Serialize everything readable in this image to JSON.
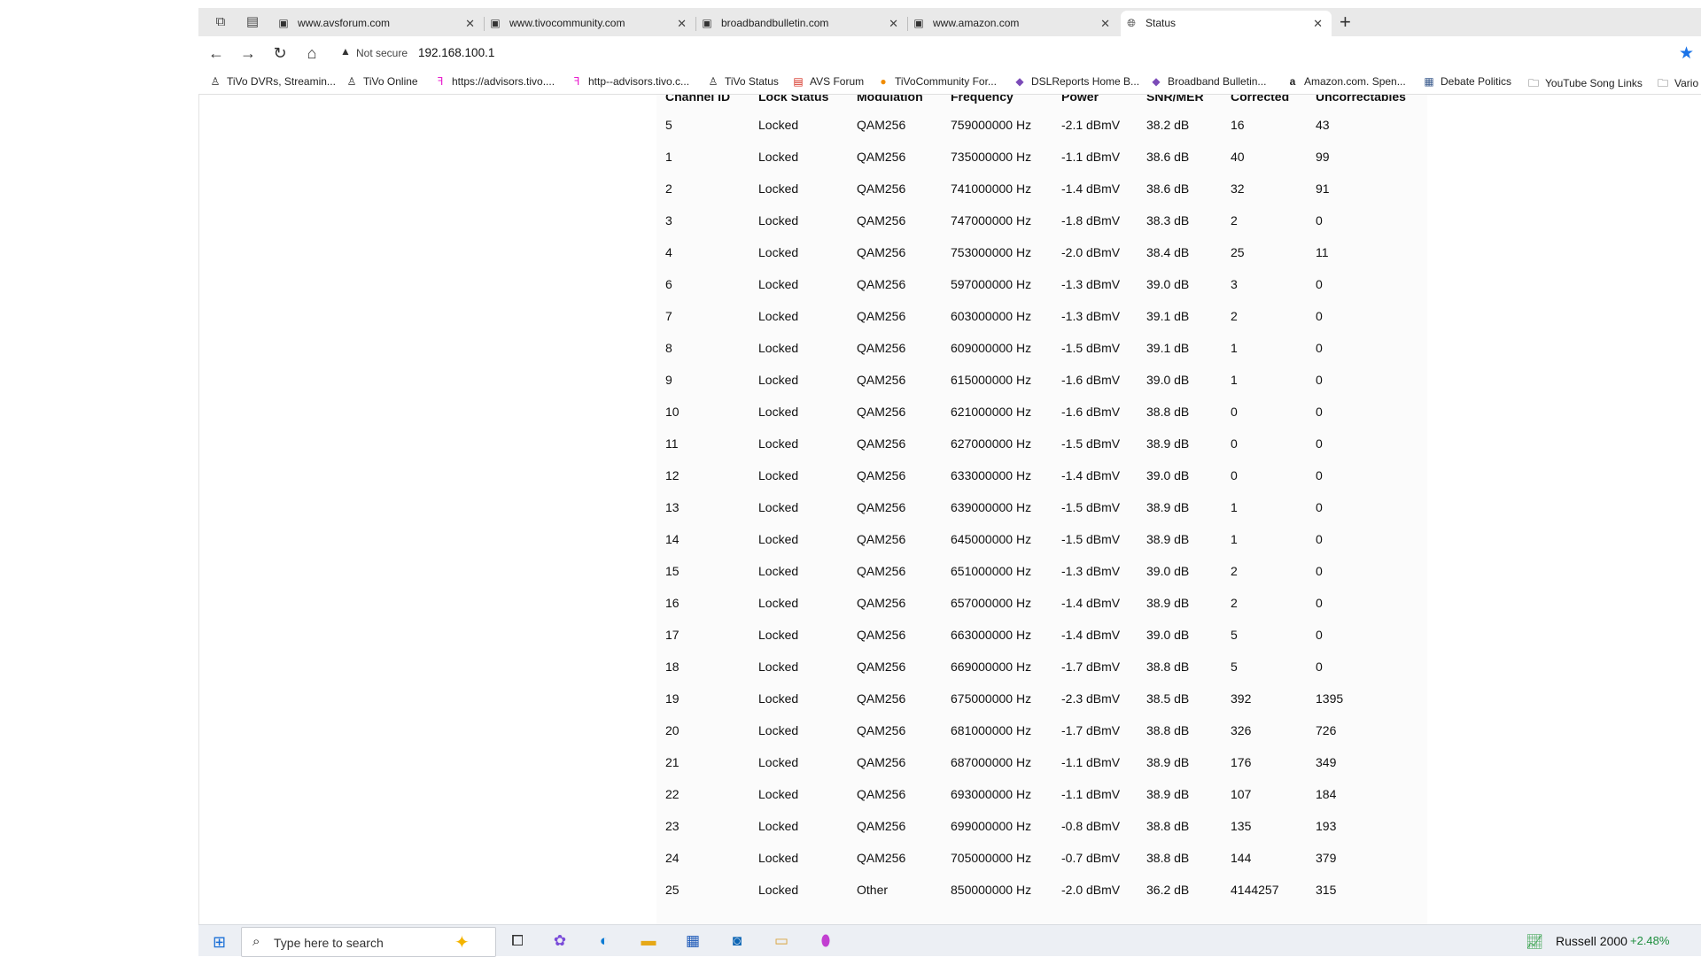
{
  "tabs": [
    {
      "title": "www.avsforum.com",
      "icon": "page-icon"
    },
    {
      "title": "www.tivocommunity.com",
      "icon": "page-icon"
    },
    {
      "title": "broadbandbulletin.com",
      "icon": "page-icon"
    },
    {
      "title": "www.amazon.com",
      "icon": "page-icon"
    },
    {
      "title": "Status",
      "icon": "globe-icon",
      "active": true
    }
  ],
  "address_bar": {
    "security": "Not secure",
    "url": "192.168.100.1"
  },
  "bookmarks": [
    {
      "label": "TiVo DVRs, Streamin..."
    },
    {
      "label": "TiVo Online"
    },
    {
      "label": "https://advisors.tivo...."
    },
    {
      "label": "http--advisors.tivo.c..."
    },
    {
      "label": "TiVo Status"
    },
    {
      "label": "AVS Forum"
    },
    {
      "label": "TiVoCommunity For..."
    },
    {
      "label": "DSLReports Home B..."
    },
    {
      "label": "Broadband Bulletin..."
    },
    {
      "label": "Amazon.com. Spen..."
    },
    {
      "label": "Debate Politics"
    },
    {
      "label": "YouTube Song Links"
    },
    {
      "label": "Vario"
    }
  ],
  "channel_table": {
    "headers": [
      "Channel ID",
      "Lock Status",
      "Modulation",
      "Frequency",
      "Power",
      "SNR/MER",
      "Corrected",
      "Uncorrectables"
    ],
    "rows": [
      [
        "5",
        "Locked",
        "QAM256",
        "759000000 Hz",
        "-2.1 dBmV",
        "38.2 dB",
        "16",
        "43"
      ],
      [
        "1",
        "Locked",
        "QAM256",
        "735000000 Hz",
        "-1.1 dBmV",
        "38.6 dB",
        "40",
        "99"
      ],
      [
        "2",
        "Locked",
        "QAM256",
        "741000000 Hz",
        "-1.4 dBmV",
        "38.6 dB",
        "32",
        "91"
      ],
      [
        "3",
        "Locked",
        "QAM256",
        "747000000 Hz",
        "-1.8 dBmV",
        "38.3 dB",
        "2",
        "0"
      ],
      [
        "4",
        "Locked",
        "QAM256",
        "753000000 Hz",
        "-2.0 dBmV",
        "38.4 dB",
        "25",
        "11"
      ],
      [
        "6",
        "Locked",
        "QAM256",
        "597000000 Hz",
        "-1.3 dBmV",
        "39.0 dB",
        "3",
        "0"
      ],
      [
        "7",
        "Locked",
        "QAM256",
        "603000000 Hz",
        "-1.3 dBmV",
        "39.1 dB",
        "2",
        "0"
      ],
      [
        "8",
        "Locked",
        "QAM256",
        "609000000 Hz",
        "-1.5 dBmV",
        "39.1 dB",
        "1",
        "0"
      ],
      [
        "9",
        "Locked",
        "QAM256",
        "615000000 Hz",
        "-1.6 dBmV",
        "39.0 dB",
        "1",
        "0"
      ],
      [
        "10",
        "Locked",
        "QAM256",
        "621000000 Hz",
        "-1.6 dBmV",
        "38.8 dB",
        "0",
        "0"
      ],
      [
        "11",
        "Locked",
        "QAM256",
        "627000000 Hz",
        "-1.5 dBmV",
        "38.9 dB",
        "0",
        "0"
      ],
      [
        "12",
        "Locked",
        "QAM256",
        "633000000 Hz",
        "-1.4 dBmV",
        "39.0 dB",
        "0",
        "0"
      ],
      [
        "13",
        "Locked",
        "QAM256",
        "639000000 Hz",
        "-1.5 dBmV",
        "38.9 dB",
        "1",
        "0"
      ],
      [
        "14",
        "Locked",
        "QAM256",
        "645000000 Hz",
        "-1.5 dBmV",
        "38.9 dB",
        "1",
        "0"
      ],
      [
        "15",
        "Locked",
        "QAM256",
        "651000000 Hz",
        "-1.3 dBmV",
        "39.0 dB",
        "2",
        "0"
      ],
      [
        "16",
        "Locked",
        "QAM256",
        "657000000 Hz",
        "-1.4 dBmV",
        "38.9 dB",
        "2",
        "0"
      ],
      [
        "17",
        "Locked",
        "QAM256",
        "663000000 Hz",
        "-1.4 dBmV",
        "39.0 dB",
        "5",
        "0"
      ],
      [
        "18",
        "Locked",
        "QAM256",
        "669000000 Hz",
        "-1.7 dBmV",
        "38.8 dB",
        "5",
        "0"
      ],
      [
        "19",
        "Locked",
        "QAM256",
        "675000000 Hz",
        "-2.3 dBmV",
        "38.5 dB",
        "392",
        "1395"
      ],
      [
        "20",
        "Locked",
        "QAM256",
        "681000000 Hz",
        "-1.7 dBmV",
        "38.8 dB",
        "326",
        "726"
      ],
      [
        "21",
        "Locked",
        "QAM256",
        "687000000 Hz",
        "-1.1 dBmV",
        "38.9 dB",
        "176",
        "349"
      ],
      [
        "22",
        "Locked",
        "QAM256",
        "693000000 Hz",
        "-1.1 dBmV",
        "38.9 dB",
        "107",
        "184"
      ],
      [
        "23",
        "Locked",
        "QAM256",
        "699000000 Hz",
        "-0.8 dBmV",
        "38.8 dB",
        "135",
        "193"
      ],
      [
        "24",
        "Locked",
        "QAM256",
        "705000000 Hz",
        "-0.7 dBmV",
        "38.8 dB",
        "144",
        "379"
      ],
      [
        "25",
        "Locked",
        "Other",
        "850000000 Hz",
        "-2.0 dBmV",
        "36.2 dB",
        "4144257",
        "315"
      ]
    ]
  },
  "taskbar": {
    "search_placeholder": "Type here to search",
    "stock_name": "Russell 2000",
    "stock_change": "+2.48%"
  },
  "colors": {
    "accent": "#1a73e8",
    "stock_up": "#1e8e3e"
  }
}
